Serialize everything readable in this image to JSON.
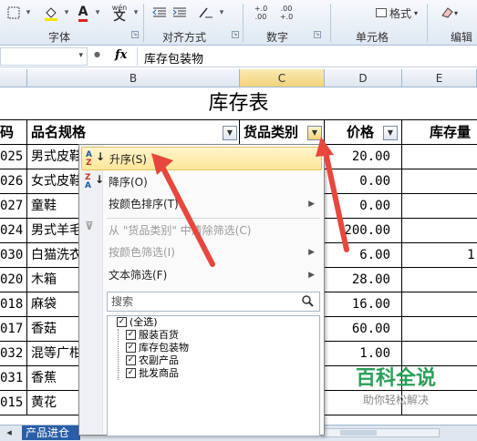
{
  "ribbon": {
    "groups": [
      "字体",
      "对齐方式",
      "数字",
      "单元格",
      "编辑"
    ],
    "number_format_btn": "格式",
    "font_color_letter": "A",
    "wen_label": "wén",
    "wen_char": "文",
    "dec_inc": "+.0 .00",
    "dec_dec": ".00 +.0"
  },
  "formula_bar": {
    "fx": "fx",
    "content": "库存包装物"
  },
  "columns": [
    "B",
    "C",
    "D",
    "E"
  ],
  "sheet": {
    "title": "库存表",
    "headers": {
      "code": "码",
      "name": "品名规格",
      "category": "货品类别",
      "price": "价格",
      "stock": "库存量"
    },
    "rows": [
      {
        "code": "025",
        "name": "男式皮鞋",
        "price": "20.00",
        "stock": ""
      },
      {
        "code": "026",
        "name": "女式皮鞋",
        "price": "0.00",
        "stock": ""
      },
      {
        "code": "027",
        "name": "童鞋",
        "price": "0.00",
        "stock": ""
      },
      {
        "code": "024",
        "name": "男式羊毛",
        "price": "200.00",
        "stock": ""
      },
      {
        "code": "030",
        "name": "白猫洗衣",
        "price": "6.00",
        "stock": "1"
      },
      {
        "code": "020",
        "name": "木箱",
        "price": "28.00",
        "stock": ""
      },
      {
        "code": "018",
        "name": "麻袋",
        "price": "16.00",
        "stock": ""
      },
      {
        "code": "017",
        "name": "香菇",
        "price": "60.00",
        "stock": ""
      },
      {
        "code": "032",
        "name": "混等广柑",
        "price": "1.00",
        "stock": ""
      },
      {
        "code": "031",
        "name": "香蕉",
        "price": "",
        "stock": ""
      },
      {
        "code": "015",
        "name": "黄花",
        "price": "",
        "stock": ""
      }
    ]
  },
  "filter_menu": {
    "sort_asc": "升序(S)",
    "sort_desc": "降序(O)",
    "sort_by_color": "按颜色排序(T)",
    "clear_filter": "从 \"货品类别\" 中清除筛选(C)",
    "filter_by_color": "按颜色筛选(I)",
    "text_filter": "文本筛选(F)",
    "search_placeholder": "搜索",
    "items": [
      "(全选)",
      "服装百货",
      "库存包装物",
      "农副产品",
      "批发商品"
    ]
  },
  "sheet_tab": "产品进仓",
  "watermark": {
    "title": "百科全说",
    "subtitle": "助你轻松解决"
  },
  "colors": {
    "highlight": "#fde699",
    "arrow": "#e8473d",
    "sheet_tab": "#2a5ea8",
    "watermark": "#2aa05a"
  }
}
